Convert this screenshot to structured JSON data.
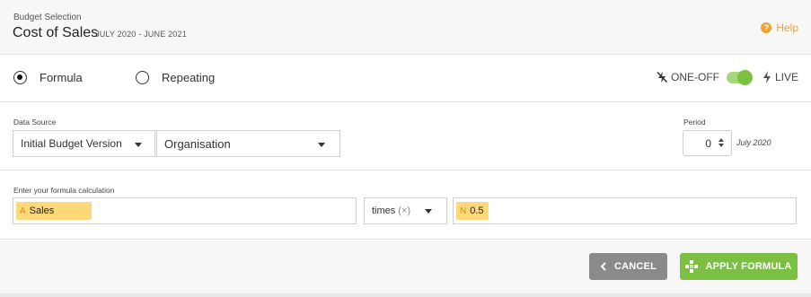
{
  "header": {
    "eyebrow": "Budget Selection",
    "title": "Cost of Sales",
    "period": "JULY 2020 - JUNE 2021",
    "help_label": "Help"
  },
  "mode": {
    "options": [
      {
        "label": "Formula",
        "selected": true
      },
      {
        "label": "Repeating",
        "selected": false
      }
    ],
    "one_off_label": "ONE-OFF",
    "live_label": "LIVE",
    "live_enabled": true
  },
  "data_source": {
    "label": "Data Source",
    "version": "Initial Budget Version",
    "entity": "Organisation"
  },
  "period": {
    "label": "Period",
    "value": "0",
    "month": "July 2020"
  },
  "formula": {
    "label": "Enter your formula calculation",
    "operand_a": {
      "tag": "A",
      "value": "Sales"
    },
    "operator": {
      "label": "times",
      "symbol": "(×)"
    },
    "operand_b": {
      "tag": "N",
      "value": "0.5"
    }
  },
  "footer": {
    "cancel_label": "CANCEL",
    "apply_label": "APPLY FORMULA"
  },
  "colors": {
    "accent_green": "#7bc043",
    "help_orange": "#f0a030",
    "chip_yellow": "#fdd97a",
    "cancel_gray": "#8a8a8a"
  }
}
